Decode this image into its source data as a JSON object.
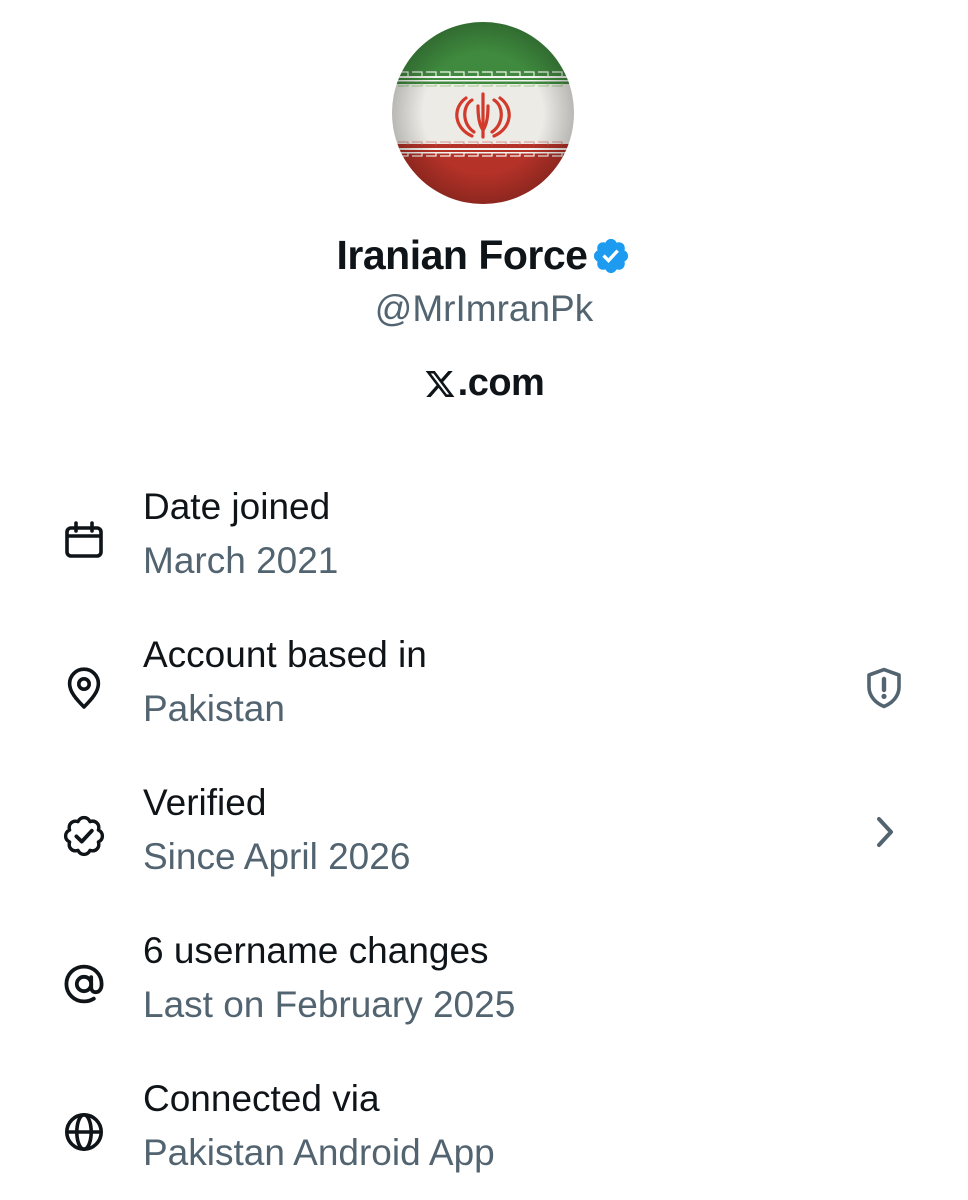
{
  "profile": {
    "display_name": "Iranian Force",
    "handle": "@MrImranPk",
    "site": ".com",
    "verified_color": "#1d9bf0",
    "avatar_icon": "iran-flag-avatar",
    "flag_colors": {
      "green": "#239f40",
      "white": "#ffffff",
      "red": "#da0000"
    }
  },
  "rows": [
    {
      "icon": "calendar-icon",
      "title": "Date joined",
      "subtitle": "March 2021"
    },
    {
      "icon": "location-pin-icon",
      "title": "Account based in",
      "subtitle": "Pakistan",
      "trailing_icon": "shield-alert-icon"
    },
    {
      "icon": "verified-outline-icon",
      "title": "Verified",
      "subtitle": "Since April 2026",
      "trailing_icon": "chevron-right-icon"
    },
    {
      "icon": "at-sign-icon",
      "title": "6 username changes",
      "subtitle": "Last on February 2025"
    },
    {
      "icon": "globe-icon",
      "title": "Connected via",
      "subtitle": "Pakistan Android App"
    }
  ],
  "colors": {
    "primary_text": "#0f1419",
    "secondary_text": "#536471"
  }
}
